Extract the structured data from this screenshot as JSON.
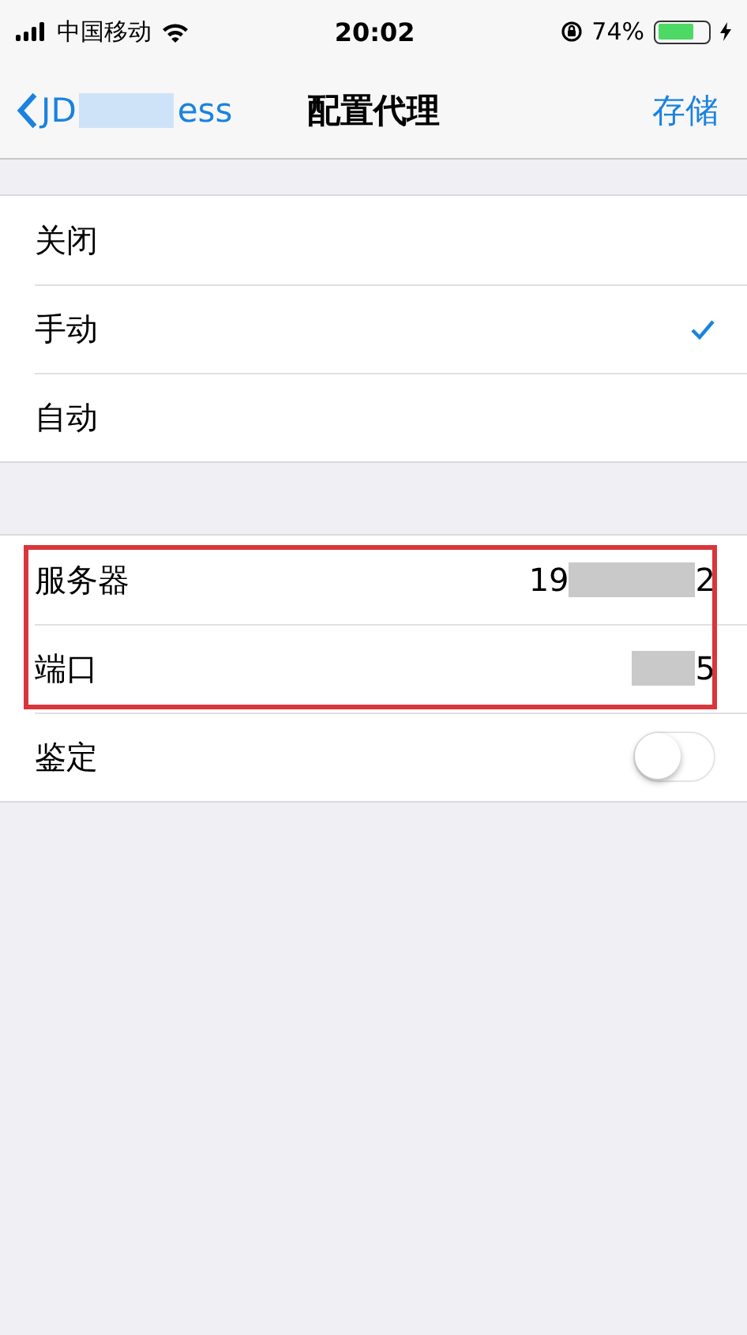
{
  "status_bar": {
    "carrier": "中国移动",
    "time": "20:02",
    "battery": "74%"
  },
  "nav": {
    "back_start": "JD",
    "back_end": "ess",
    "title": "配置代理",
    "action": "存储"
  },
  "modes": [
    {
      "label": "关闭",
      "selected": false
    },
    {
      "label": "手动",
      "selected": true
    },
    {
      "label": "自动",
      "selected": false
    }
  ],
  "fields": [
    {
      "kind": "value",
      "label": "服务器",
      "value_start": "19",
      "value_end": "2",
      "highlighted": true
    },
    {
      "kind": "value",
      "label": "端口",
      "value_end": "5",
      "highlighted": true
    },
    {
      "kind": "toggle",
      "label": "鉴定",
      "on": false,
      "highlighted": false
    }
  ]
}
